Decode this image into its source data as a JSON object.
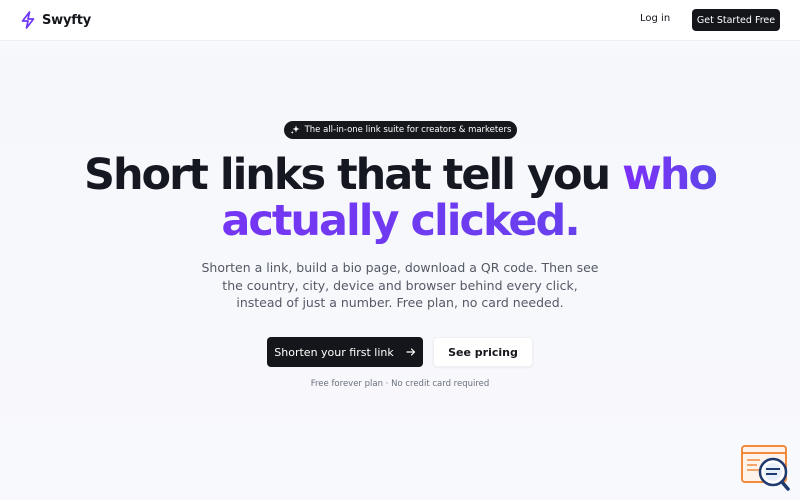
{
  "nav": {
    "brand": "Swyfty",
    "login": "Log in",
    "cta": "Get Started Free",
    "brand_icon": "lightning-bolt-icon"
  },
  "hero": {
    "badge": "The all-in-one link suite for creators & marketers",
    "badge_icon": "sparkles-icon",
    "headline_line1": "Short links that tell you",
    "headline_accent1": "who",
    "headline_line2": "actually clicked.",
    "subtext": "Shorten a link, build a bio page, download a QR code. Then see the country, city, device and browser behind every click, instead of just a number. Free plan, no card needed.",
    "primary_cta": "Shorten your first link",
    "primary_cta_icon": "arrow-right-icon",
    "secondary_cta": "See pricing",
    "fineprint": "Free forever plan · No credit card required"
  },
  "widget": {
    "icon": "chat-search-widget-icon"
  },
  "colors": {
    "accent": "#6d34f3",
    "dark": "#15161b",
    "background": "#f8f9fc",
    "widget_orange": "#f08a3c",
    "widget_navy": "#1e3a6e"
  }
}
